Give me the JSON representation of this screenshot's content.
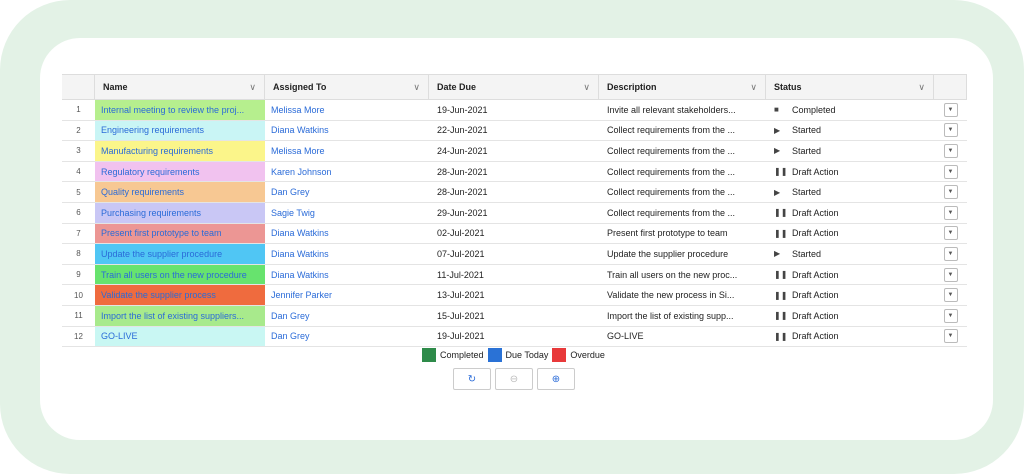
{
  "columns": {
    "name": "Name",
    "assigned_to": "Assigned To",
    "date_due": "Date Due",
    "description": "Description",
    "status": "Status"
  },
  "rows": [
    {
      "idx": "1",
      "name": "Internal meeting to review the proj...",
      "assigned": "Melissa More",
      "date": "19-Jun-2021",
      "desc": "Invite all relevant stakeholders...",
      "status": "Completed",
      "status_icon": "stop-icon",
      "color": "#b6ef8e"
    },
    {
      "idx": "2",
      "name": "Engineering requirements",
      "assigned": "Diana Watkins",
      "date": "22-Jun-2021",
      "desc": "Collect requirements from the ...",
      "status": "Started",
      "status_icon": "play-icon",
      "color": "#c9f5f5"
    },
    {
      "idx": "3",
      "name": "Manufacturing requirements",
      "assigned": "Melissa More",
      "date": "24-Jun-2021",
      "desc": "Collect requirements from the ...",
      "status": "Started",
      "status_icon": "play-icon",
      "color": "#fbf58a"
    },
    {
      "idx": "4",
      "name": "Regulatory requirements",
      "assigned": "Karen Johnson",
      "date": "28-Jun-2021",
      "desc": "Collect requirements from the ...",
      "status": "Draft Action",
      "status_icon": "pause-icon",
      "color": "#f1c2ef"
    },
    {
      "idx": "5",
      "name": "Quality requirements",
      "assigned": "Dan Grey",
      "date": "28-Jun-2021",
      "desc": "Collect requirements from the ...",
      "status": "Started",
      "status_icon": "play-icon",
      "color": "#f7c893"
    },
    {
      "idx": "6",
      "name": "Purchasing requirements",
      "assigned": "Sagie Twig",
      "date": "29-Jun-2021",
      "desc": "Collect requirements from the ...",
      "status": "Draft Action",
      "status_icon": "pause-icon",
      "color": "#c9c7f5"
    },
    {
      "idx": "7",
      "name": "Present first prototype to team",
      "assigned": "Diana Watkins",
      "date": "02-Jul-2021",
      "desc": "Present first prototype to team",
      "status": "Draft Action",
      "status_icon": "pause-icon",
      "color": "#ec9694"
    },
    {
      "idx": "8",
      "name": "Update the supplier procedure",
      "assigned": "Diana Watkins",
      "date": "07-Jul-2021",
      "desc": "Update the supplier procedure",
      "status": "Started",
      "status_icon": "play-icon",
      "color": "#50c6f4"
    },
    {
      "idx": "9",
      "name": "Train all users on the new procedure",
      "assigned": "Diana Watkins",
      "date": "11-Jul-2021",
      "desc": "Train all users on the new proc...",
      "status": "Draft Action",
      "status_icon": "pause-icon",
      "color": "#67e36e"
    },
    {
      "idx": "10",
      "name": "Validate the supplier process",
      "assigned": "Jennifer Parker",
      "date": "13-Jul-2021",
      "desc": "Validate the new process in Si...",
      "status": "Draft Action",
      "status_icon": "pause-icon",
      "color": "#ef6b3e"
    },
    {
      "idx": "11",
      "name": "Import the list of existing suppliers...",
      "assigned": "Dan Grey",
      "date": "15-Jul-2021",
      "desc": "Import the list of existing supp...",
      "status": "Draft Action",
      "status_icon": "pause-icon",
      "color": "#a8ea8c"
    },
    {
      "idx": "12",
      "name": "GO-LIVE",
      "assigned": "Dan Grey",
      "date": "19-Jul-2021",
      "desc": "GO-LIVE",
      "status": "Draft Action",
      "status_icon": "pause-icon",
      "color": "#c9f7f3"
    }
  ],
  "legend": [
    {
      "label": "Completed",
      "color": "#2e8b4a"
    },
    {
      "label": "Due Today",
      "color": "#2a72d6"
    },
    {
      "label": "Overdue",
      "color": "#e8393a"
    }
  ],
  "toolbar": [
    {
      "name": "refresh-icon",
      "glyph": "↻",
      "color": "#2a6bd8"
    },
    {
      "name": "zoom-out-icon",
      "glyph": "⊖",
      "color": "#bbbbbb"
    },
    {
      "name": "zoom-in-icon",
      "glyph": "⊕",
      "color": "#2a6bd8"
    }
  ]
}
